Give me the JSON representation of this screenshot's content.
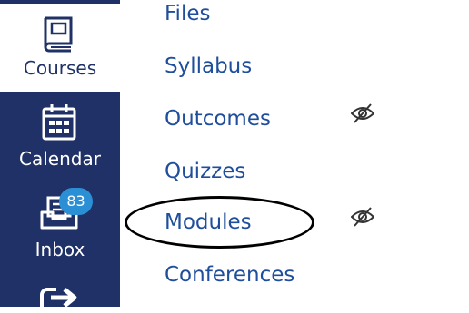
{
  "global_nav": {
    "items": [
      {
        "label": "Courses",
        "icon": "courses-book-icon",
        "active": true
      },
      {
        "label": "Calendar",
        "icon": "calendar-icon",
        "active": false
      },
      {
        "label": "Inbox",
        "icon": "inbox-icon",
        "active": false,
        "badge": "83"
      },
      {
        "label": "",
        "icon": "logout-arrow-icon",
        "active": false
      }
    ]
  },
  "course_nav": {
    "links": [
      {
        "label": "Files",
        "hidden": false
      },
      {
        "label": "Syllabus",
        "hidden": false
      },
      {
        "label": "Outcomes",
        "hidden": true,
        "icon": "eye-slash-icon"
      },
      {
        "label": "Quizzes",
        "hidden": false
      },
      {
        "label": "Modules",
        "hidden": true,
        "icon": "eye-slash-icon",
        "circled": true
      },
      {
        "label": "Conferences",
        "hidden": false
      }
    ]
  },
  "colors": {
    "nav_background": "#1f3166",
    "link": "#1f4e9c",
    "badge": "#2b8fd6",
    "annotation": "#000000"
  }
}
